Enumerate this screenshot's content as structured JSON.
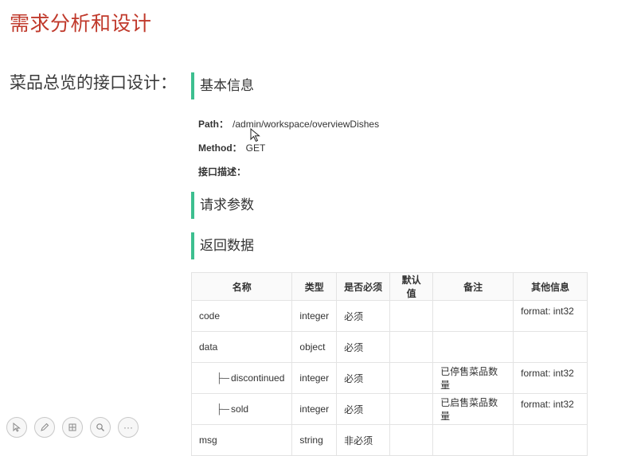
{
  "slide": {
    "title": "需求分析和设计",
    "subtitle": "菜品总览的接口设计："
  },
  "sections": {
    "basic_info": "基本信息",
    "request_params": "请求参数",
    "response_data": "返回数据"
  },
  "api": {
    "path_label": "Path：",
    "path_value": "/admin/workspace/overviewDishes",
    "method_label": "Method：",
    "method_value": "GET",
    "desc_label": "接口描述："
  },
  "table": {
    "headers": [
      "名称",
      "类型",
      "是否必须",
      "默认值",
      "备注",
      "其他信息"
    ],
    "rows": [
      {
        "name": "code",
        "type": "integer",
        "required": "必须",
        "default": "",
        "note": "",
        "other": "format: int32"
      },
      {
        "name": "data",
        "type": "object",
        "required": "必须",
        "default": "",
        "note": "",
        "other": ""
      },
      {
        "name": "discontinued",
        "type": "integer",
        "required": "必须",
        "default": "",
        "note": "已停售菜品数量",
        "other": "format: int32"
      },
      {
        "name": "sold",
        "type": "integer",
        "required": "必须",
        "default": "",
        "note": "已启售菜品数量",
        "other": "format: int32"
      },
      {
        "name": "msg",
        "type": "string",
        "required": "非必须",
        "default": "",
        "note": "",
        "other": ""
      }
    ],
    "tree_prefix": "├─"
  },
  "toolbar": {
    "icons": [
      "pointer-icon",
      "pen-icon",
      "grid-icon",
      "zoom-icon",
      "more-icon"
    ],
    "more_glyph": "···"
  },
  "colors": {
    "title": "#c0392b",
    "section_bar": "#3dbf8f"
  }
}
